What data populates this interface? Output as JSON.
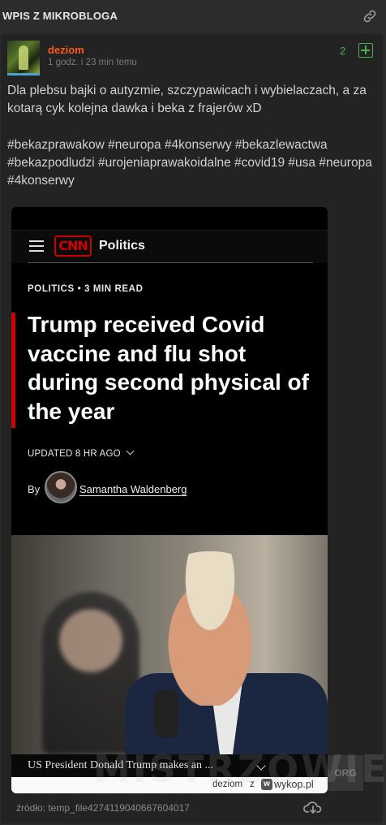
{
  "section": {
    "title": "WPIS Z MIKROBLOGA",
    "link_icon": "link-icon"
  },
  "post": {
    "username": "deziom",
    "timestamp": "1 godz. i 23 min temu",
    "votes": "2",
    "body": "Dla plebsu bajki o autyzmie, szczypawicach i wybielaczach, a za kotarą cyk kolejna dawka i beka z frajerów xD",
    "tags": "#bekazprawakow #neuropa #4konserwy #bekazlewactwa #bekazpodludzi #urojeniaprawakoidalne #covid19 #usa #neuropa #4konserwy"
  },
  "embed": {
    "cnn_logo": "CNN",
    "section_name": "Politics",
    "kicker": "POLITICS • 3 MIN READ",
    "headline": "Trump received Covid vaccine and flu shot during second physical of the year",
    "updated": "UPDATED 8 HR AGO",
    "byline_by": "By",
    "author": "Samantha Waldenberg",
    "caption": "US President Donald Trump makes an ...",
    "watermark_user": "deziom",
    "watermark_z": "z",
    "wykop_logo": "w",
    "wykop_text": "wykop.pl"
  },
  "watermarks": {
    "mistrzowie": "MISTRZOWIE",
    "org": "ORG"
  },
  "footer": {
    "source": "źródło: temp_file4274119040667604017"
  },
  "colors": {
    "username": "#ff5917",
    "vote": "#4caf50",
    "cnn_red": "#cc0000",
    "background": "#2c2c2c",
    "card": "#232323"
  }
}
